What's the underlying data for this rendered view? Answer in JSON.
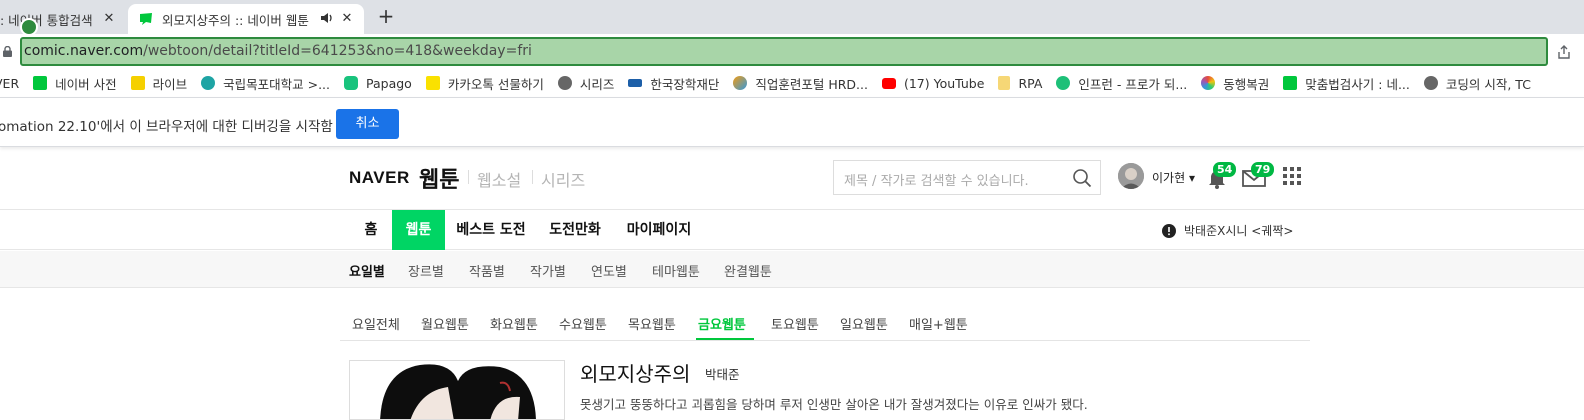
{
  "browser": {
    "tabs": [
      {
        "title": ": 네이버 통합검색",
        "active": false
      },
      {
        "title": "외모지상주의 :: 네이버 웹툰",
        "active": true
      }
    ],
    "new_tab_label": "+",
    "close_label": "✕",
    "url": {
      "host": "comic.naver.com",
      "path": "/webtoon/detail?titleId=641253&no=418&weekday=fri"
    },
    "omnibox_highlight_color": "#a8d5a8",
    "bookmarks": [
      {
        "label": "VER",
        "icon": "naver-icon",
        "color": "#ffffff"
      },
      {
        "label": "네이버 사전",
        "icon": "naver-dictionary-icon",
        "color": "#00c73c"
      },
      {
        "label": "라이브",
        "icon": "afreeca-icon",
        "color": "#f5d000"
      },
      {
        "label": "국립목포대학교 >...",
        "icon": "mokpo-university-icon",
        "color": "#1ea4a4"
      },
      {
        "label": "Papago",
        "icon": "papago-icon",
        "color": "#19c37d"
      },
      {
        "label": "카카오톡 선물하기",
        "icon": "kakao-gift-icon",
        "color": "#fae100"
      },
      {
        "label": "시리즈",
        "icon": "globe-icon",
        "color": "#666666"
      },
      {
        "label": "한국장학재단",
        "icon": "graduation-cap-icon",
        "color": "#1d5fa8"
      },
      {
        "label": "직업훈련포털 HRD...",
        "icon": "hrd-icon",
        "color": "#f39c12"
      },
      {
        "label": "(17) YouTube",
        "icon": "youtube-icon",
        "color": "#ff0000"
      },
      {
        "label": "RPA",
        "icon": "folder-icon",
        "color": "#f6d776"
      },
      {
        "label": "인프런 - 프로가 되...",
        "icon": "inflearn-icon",
        "color": "#1dc078"
      },
      {
        "label": "동행복권",
        "icon": "lottery-icon",
        "color": "#e74c3c"
      },
      {
        "label": "맞춤법검사기 : 네...",
        "icon": "naver-spellcheck-icon",
        "color": "#00c73c"
      },
      {
        "label": "코딩의 시작, TC",
        "icon": "globe-icon",
        "color": "#666666"
      }
    ],
    "infobar": {
      "message": "omation 22.10'에서 이 브라우저에 대한 디버깅을 시작함",
      "cancel_label": "취소"
    }
  },
  "header": {
    "logo": "NAVER",
    "service_title": "웹툰",
    "service_links": [
      "웹소설",
      "시리즈"
    ],
    "search_placeholder": "제목 / 작가로 검색할 수 있습니다.",
    "user_name": "이가현",
    "notification_count": "54",
    "mail_count": "79"
  },
  "lnb": {
    "items": [
      "홈",
      "웹툰",
      "베스트 도전",
      "도전만화",
      "마이페이지"
    ],
    "active": "웹툰",
    "notice": "박태준X시니 <궤짝>"
  },
  "subnav": {
    "items": [
      "요일별",
      "장르별",
      "작품별",
      "작가별",
      "연도별",
      "테마웹툰",
      "완결웹툰"
    ],
    "active": "요일별"
  },
  "day_tabs": {
    "items": [
      "요일전체",
      "월요웹툰",
      "화요웹툰",
      "수요웹툰",
      "목요웹툰",
      "금요웹툰",
      "토요웹툰",
      "일요웹툰",
      "매일+웹툰"
    ],
    "active": "금요웹툰"
  },
  "comic": {
    "title": "외모지상주의",
    "author": "박태준",
    "description": "못생기고 뚱뚱하다고 괴롭힘을 당하며 루저 인생만 살아온 내가 잘생겨졌다는 이유로 인싸가 됐다."
  },
  "colors": {
    "accent_green": "#00c73c",
    "lnb_active": "#00d564",
    "cancel_button": "#1a73e8"
  }
}
